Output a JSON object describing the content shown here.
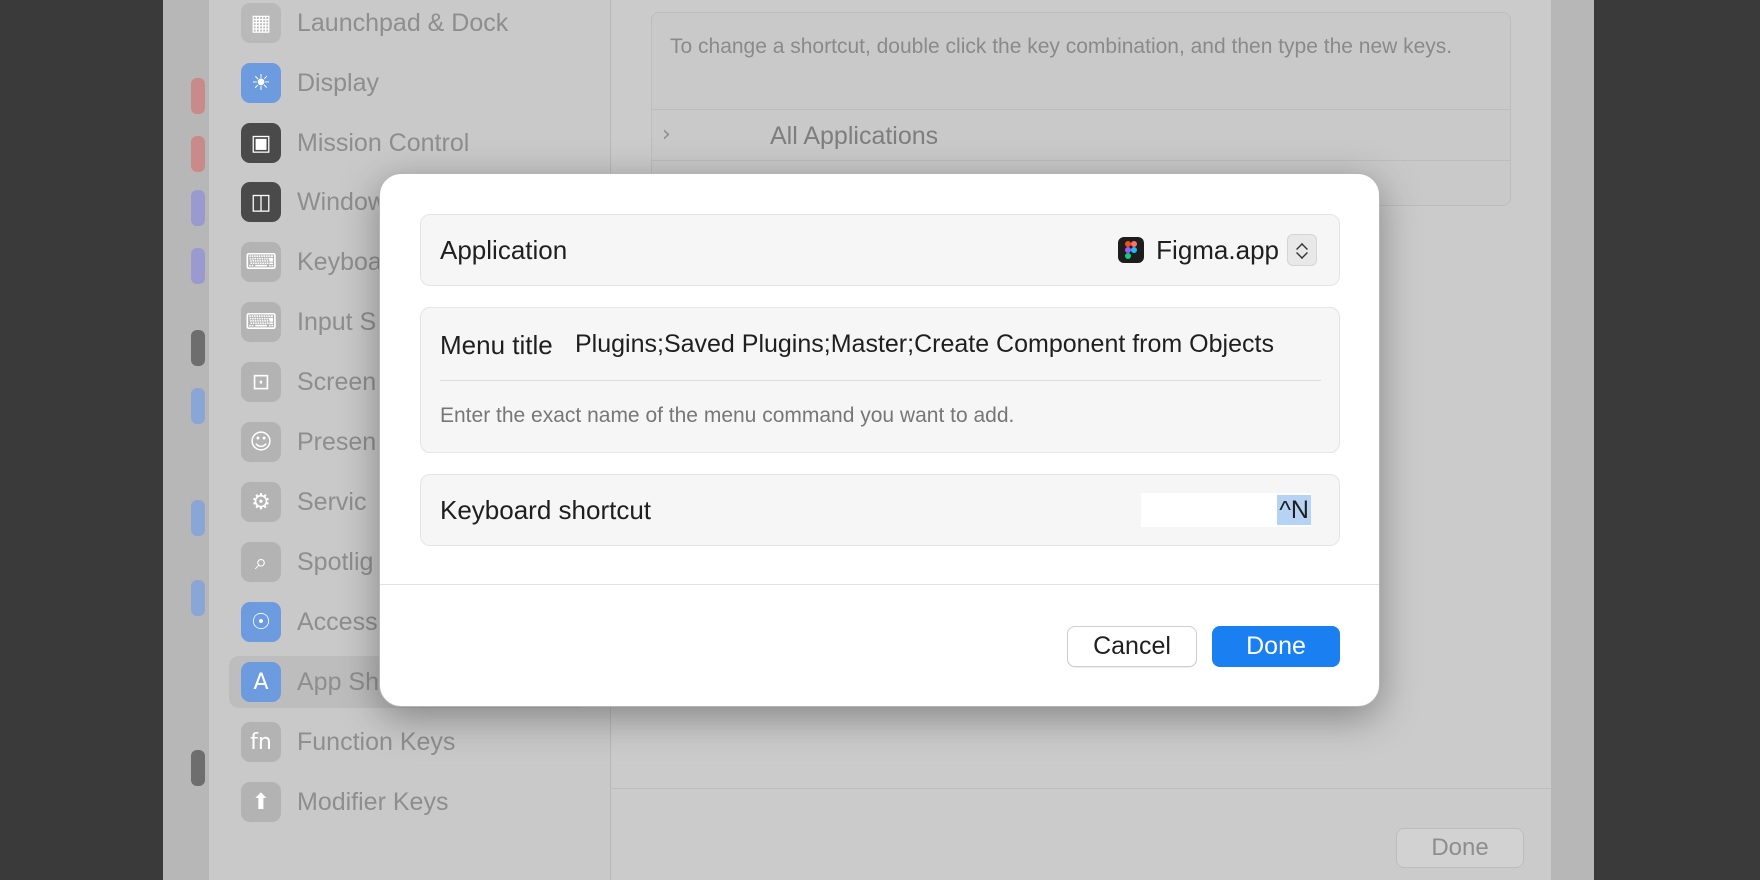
{
  "sidebar": {
    "items": [
      {
        "label": "Launchpad & Dock",
        "icon": "launchpad-icon",
        "color": "#9a9a9a"
      },
      {
        "label": "Display",
        "icon": "sun-icon",
        "color": "#4f8ee6"
      },
      {
        "label": "Mission Control",
        "icon": "mission-control-icon",
        "color": "#3d3d3d"
      },
      {
        "label": "Window",
        "icon": "window-icon",
        "color": "#3d3d3d"
      },
      {
        "label": "Keyboa",
        "icon": "keyboard-icon",
        "color": "#a8a8a8"
      },
      {
        "label": "Input S",
        "icon": "keyboard-icon",
        "color": "#a8a8a8"
      },
      {
        "label": "Screen",
        "icon": "screenshot-icon",
        "color": "#a8a8a8"
      },
      {
        "label": "Presen",
        "icon": "presenter-icon",
        "color": "#a8a8a8"
      },
      {
        "label": "Servic",
        "icon": "gears-icon",
        "color": "#a8a8a8"
      },
      {
        "label": "Spotlig",
        "icon": "magnifier-icon",
        "color": "#a8a8a8"
      },
      {
        "label": "Access",
        "icon": "accessibility-icon",
        "color": "#4f8ee6"
      },
      {
        "label": "App Sh",
        "icon": "app-store-icon",
        "color": "#4f8ee6"
      },
      {
        "label": "Function Keys",
        "icon": "fn-icon",
        "color": "#a8a8a8"
      },
      {
        "label": "Modifier Keys",
        "icon": "arrow-up-icon",
        "color": "#a8a8a8"
      }
    ]
  },
  "content": {
    "info_text": "To change a shortcut, double click the key combination, and then type the new keys.",
    "all_applications_label": "All Applications",
    "done_label": "Done"
  },
  "dialog": {
    "application_label": "Application",
    "application_value": "Figma.app",
    "menu_title_label": "Menu title",
    "menu_title_value": "Plugins;Saved Plugins;Master;Create Component from Objects",
    "menu_hint": "Enter the exact name of the menu command you want to add.",
    "shortcut_label": "Keyboard shortcut",
    "shortcut_value": "^N",
    "cancel_label": "Cancel",
    "done_label": "Done",
    "accent_color": "#1a7ff0"
  }
}
